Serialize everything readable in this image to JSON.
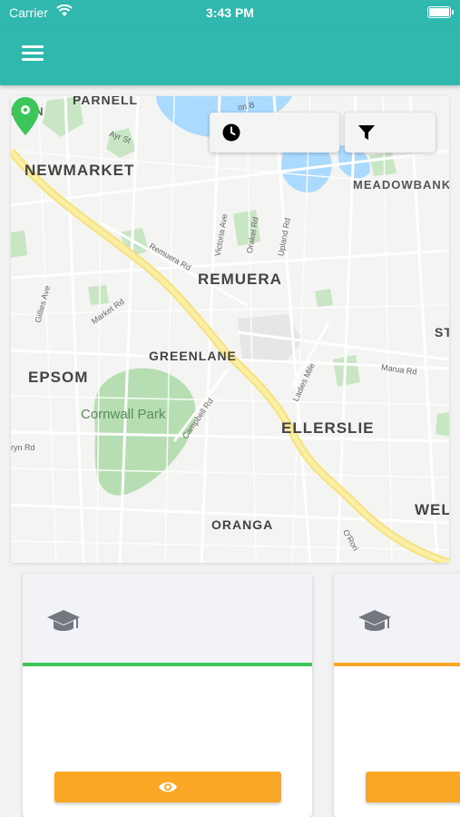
{
  "status_bar": {
    "carrier": "Carrier",
    "time": "3:43 PM"
  },
  "header": {
    "menu_icon": "hamburger-menu-icon",
    "background": "#30b8ae"
  },
  "map": {
    "controls": [
      {
        "icon": "clock-icon"
      },
      {
        "icon": "filter-icon"
      }
    ],
    "pin_color": "#3cc65a",
    "labels": {
      "parnell": "PARNELL",
      "fton": "FTON",
      "newmarket": "NEWMARKET",
      "meadowbank": "MEADOWBANK",
      "remuera": "REMUERA",
      "greenlane": "GREENLANE",
      "epsom": "EPSOM",
      "cornwall_park": "Cornwall Park",
      "ellerslie": "ELLERSLIE",
      "oranga": "ORANGA",
      "wel": "WEL",
      "st": "ST"
    },
    "roads": {
      "ayr_st": "Ayr St",
      "victoria_ave": "Victoria Ave",
      "orakei_rd": "Orakei Rd",
      "upland_rd": "Upland Rd",
      "remuera_rd": "Remuera Rd",
      "gillies_ave": "Gillies Ave",
      "market_rd": "Market Rd",
      "campbell_rd": "Campbell Rd",
      "ladies_mile": "Ladies Mile",
      "marua_rd": "Marua Rd",
      "ryn_rd": "ryn Rd",
      "orakei_short": "O'Rori",
      "on_b": "on B"
    }
  },
  "cards": [
    {
      "icon": "graduation-cap-icon",
      "accent": "#3cc65a",
      "button_icon": "eye-icon"
    },
    {
      "icon": "graduation-cap-icon",
      "accent": "#fba726",
      "button_icon": "eye-icon"
    }
  ],
  "colors": {
    "button": "#fba726",
    "green": "#3cc65a",
    "orange": "#fba726"
  }
}
